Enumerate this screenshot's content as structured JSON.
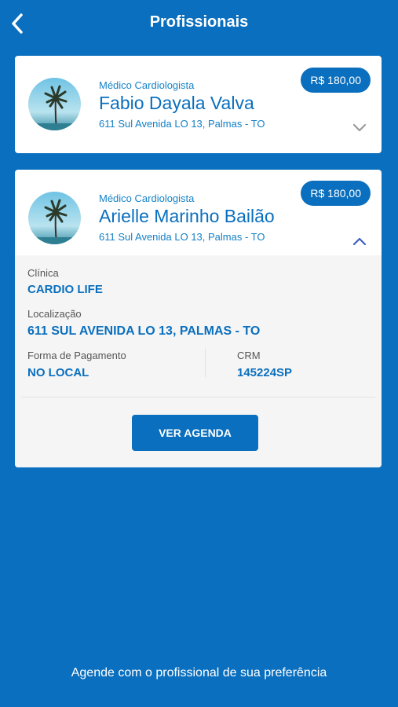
{
  "header": {
    "title": "Profissionais",
    "back_icon": "chevron-left-icon"
  },
  "professionals": [
    {
      "specialty": "Médico Cardiologista",
      "name": "Fabio Dayala Valva",
      "address": "611 Sul Avenida LO 13, Palmas - TO",
      "price": "R$ 180,00",
      "expanded": false
    },
    {
      "specialty": "Médico Cardiologista",
      "name": "Arielle Marinho Bailão",
      "address": "611 Sul Avenida LO 13, Palmas - TO",
      "price": "R$ 180,00",
      "expanded": true,
      "details": {
        "clinic_label": "Clínica",
        "clinic_value": "CARDIO LIFE",
        "location_label": "Localização",
        "location_value": "611 SUL AVENIDA LO 13, PALMAS - TO",
        "payment_label": "Forma de Pagamento",
        "payment_value": "NO LOCAL",
        "crm_label": "CRM",
        "crm_value": "145224SP",
        "agenda_button": "VER AGENDA"
      }
    }
  ],
  "footer": {
    "text": "Agende com o profissional de sua preferência"
  },
  "colors": {
    "primary": "#0a6fbe",
    "card": "#ffffff",
    "details_bg": "#f5f5f5"
  }
}
